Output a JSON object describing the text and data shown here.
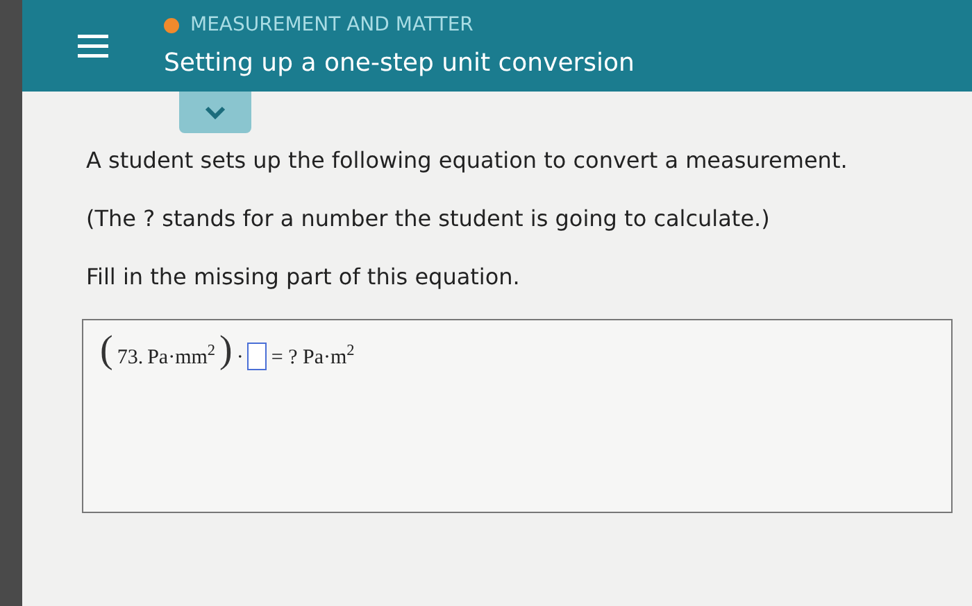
{
  "header": {
    "category": "MEASUREMENT AND MATTER",
    "title": "Setting up a one-step unit conversion"
  },
  "paragraphs": [
    "A student sets up the following equation to convert a measurement.",
    "(The ? stands for a number the student is going to calculate.)",
    "Fill in the missing part of this equation."
  ],
  "equation": {
    "open_paren": "(",
    "value": "73.",
    "unit": "Pa·mm$^{2}$",
    "close_paren": ")",
    "dot": "·",
    "result": "= ? Pa·m$^{2}$"
  }
}
